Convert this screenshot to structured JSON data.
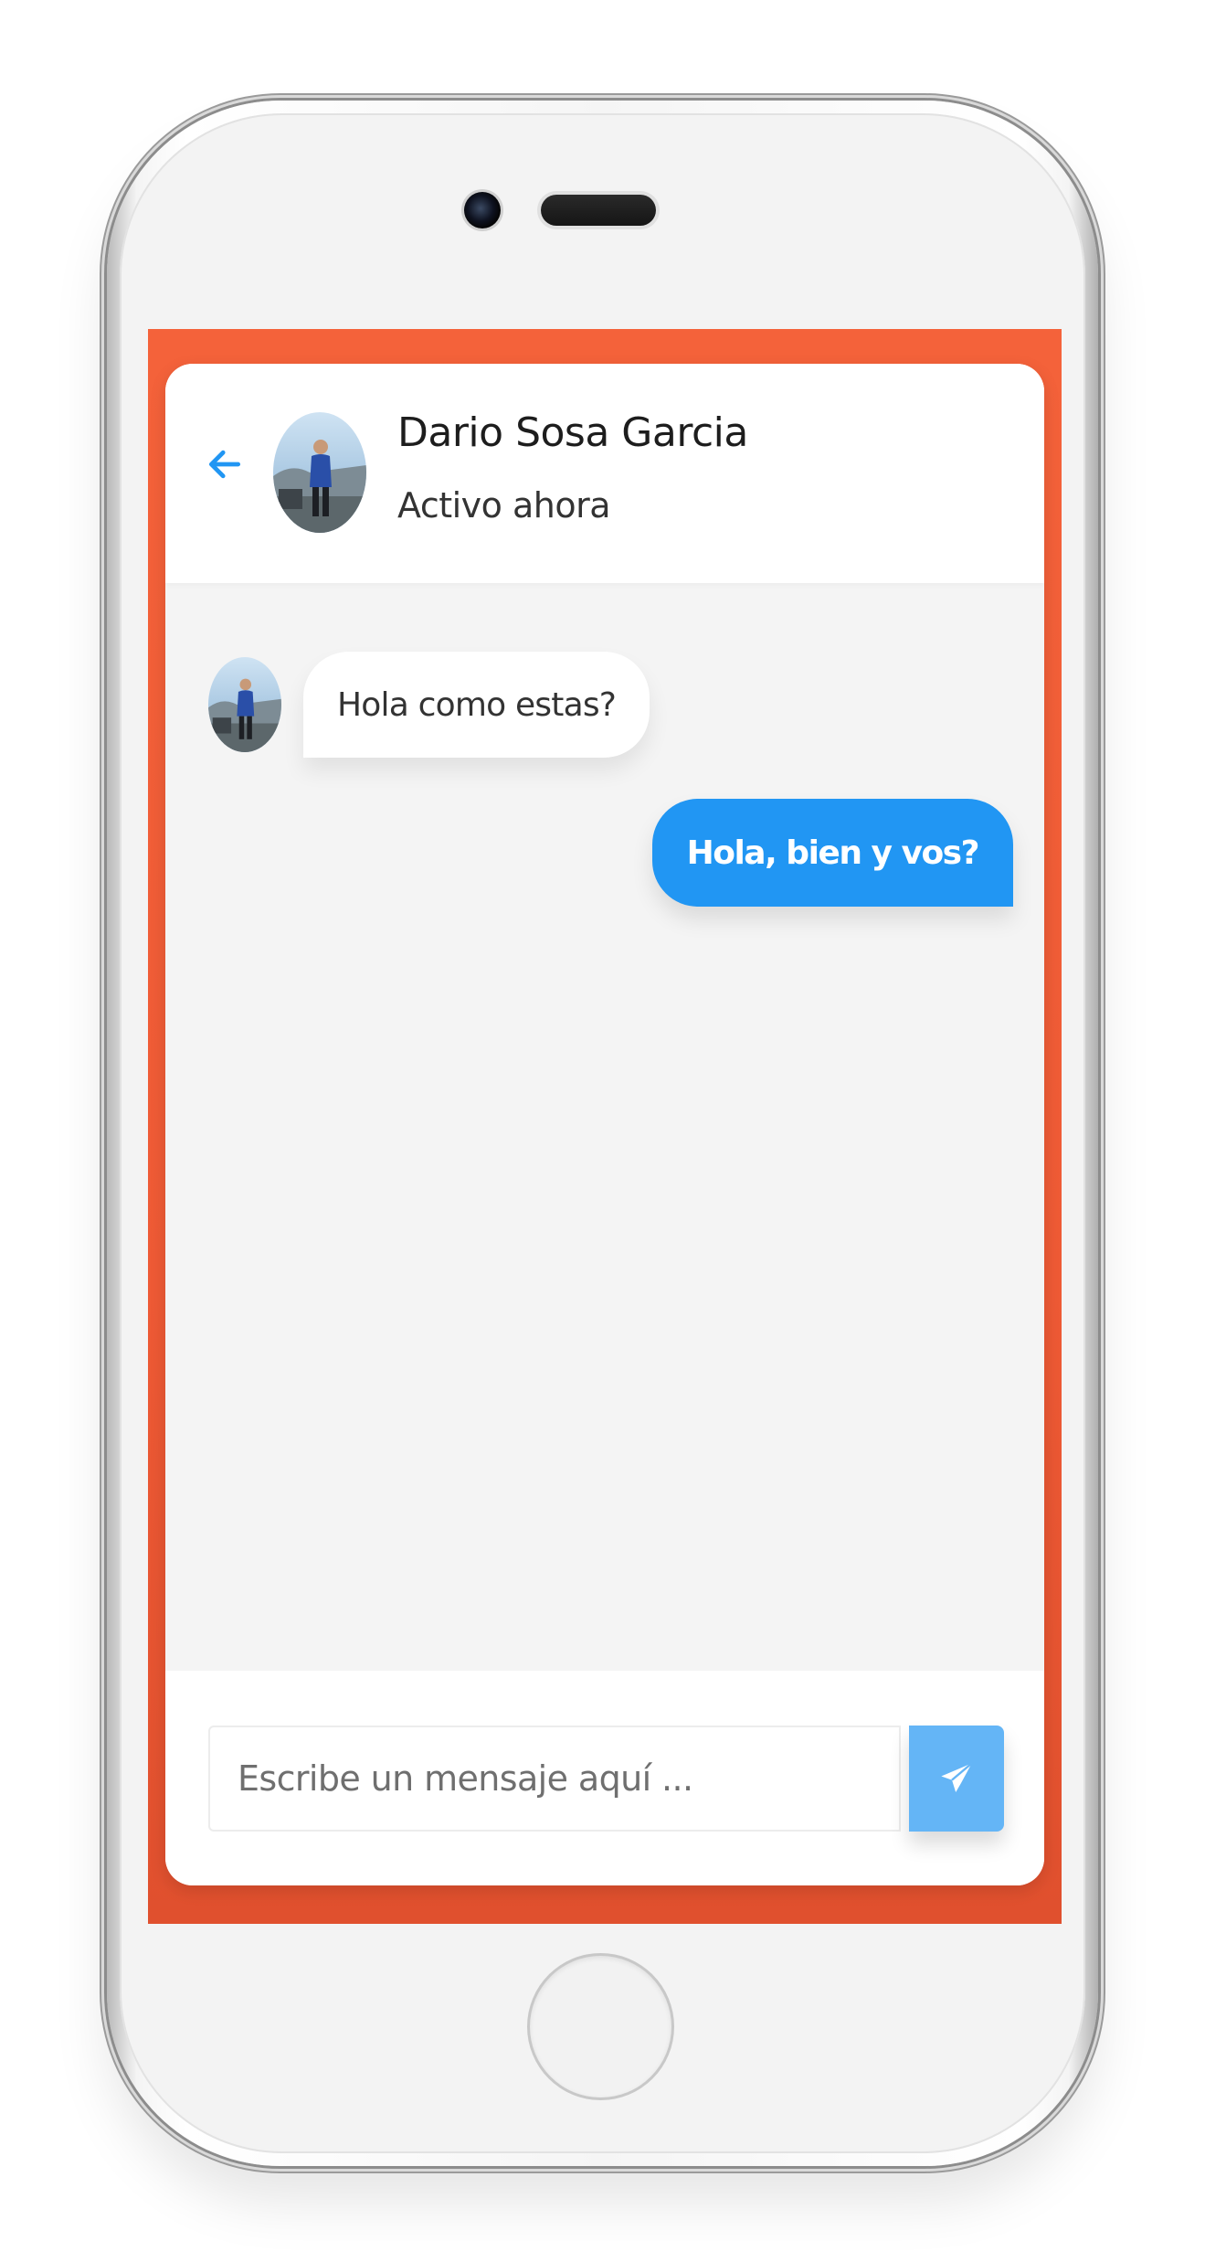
{
  "contact": {
    "name": "Dario Sosa Garcia",
    "status": "Activo ahora",
    "avatar_icon": "avatar"
  },
  "header": {
    "back_icon": "arrow-left-icon"
  },
  "messages": [
    {
      "direction": "incoming",
      "text": "Hola como estas?"
    },
    {
      "direction": "outgoing",
      "text": "Hola, bien y vos?"
    }
  ],
  "composer": {
    "placeholder": "Escribe un mensaje aquí ...",
    "value": "",
    "send_icon": "paper-plane-icon"
  },
  "colors": {
    "accent": "#2196f3",
    "accent_light": "#64b5f6",
    "screen_background": "#f4623a",
    "chat_background": "#f4f4f4",
    "bubble_incoming": "#ffffff"
  }
}
